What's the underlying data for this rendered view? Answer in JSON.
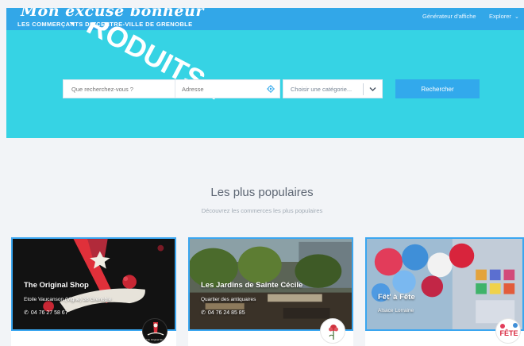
{
  "header": {
    "brand_script": "Mon excuse bonheur",
    "brand_sub": "LES COMMERÇANTS DU CENTRE-VILLE DE GRENOBLE",
    "nav": [
      {
        "label": "Générateur d'affiche"
      },
      {
        "label": "Explorer"
      }
    ]
  },
  "hero": {
    "decorative_text": "PRODUITS ?"
  },
  "search": {
    "keyword_placeholder": "Que recherchez-vous ?",
    "address_placeholder": "Adresse",
    "category_placeholder": "Choisir une catégorie...",
    "button_label": "Rechercher"
  },
  "section": {
    "title": "Les plus populaires",
    "subtitle": "Découvrez les commerces les plus populaires"
  },
  "cards": [
    {
      "title": "The Original Shop",
      "address": "Etoile Vaucanson (Vigne) 38 Grenoble",
      "phone": "04 76 27 58 67",
      "logo_text": "The Original Shop"
    },
    {
      "title": "Les Jardins de Sainte Cécile",
      "address": "Quartier des antiquaires",
      "phone": "04 76 24 85 85"
    },
    {
      "title": "Fêt' à Fête",
      "address": "Alsace Lorraine",
      "logo_text": "FÊTE"
    }
  ],
  "colors": {
    "hero_bg": "#36d3e4",
    "header_strip": "#32a7e8",
    "accent": "#3aa6f0"
  }
}
